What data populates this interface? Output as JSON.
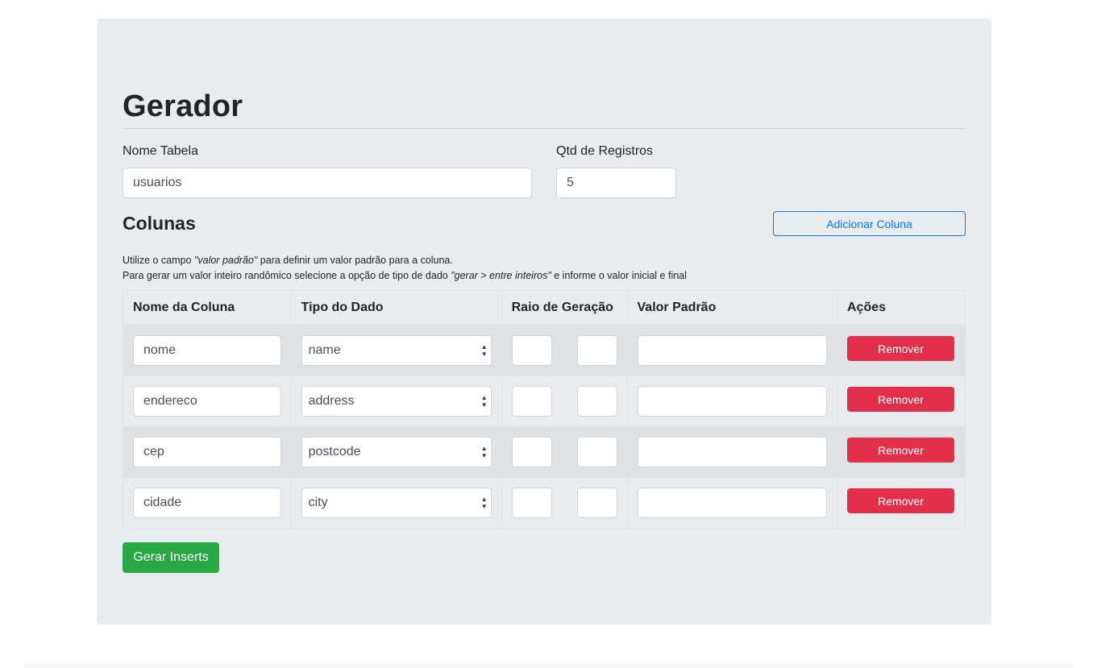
{
  "page": {
    "title": "Gerador"
  },
  "form": {
    "table_name_label": "Nome Tabela",
    "table_name_value": "usuarios",
    "qty_label": "Qtd de Registros",
    "qty_value": "5"
  },
  "columns_section": {
    "title": "Colunas",
    "add_button": "Adicionar Coluna",
    "help_line1_prefix": "Utilize o campo ",
    "help_line1_em": "\"valor padrão\"",
    "help_line1_suffix": " para definir um valor padrão para a coluna.",
    "help_line2_prefix": "Para gerar um valor inteiro randômico selecione a opção de tipo de dado ",
    "help_line2_em": "\"gerar > entre inteiros\"",
    "help_line2_suffix": " e informe o valor inicial e final"
  },
  "table": {
    "headers": [
      "Nome da Coluna",
      "Tipo do Dado",
      "Raio de Geração",
      "Valor Padrão",
      "Ações"
    ],
    "rows": [
      {
        "name": "nome",
        "type": "name",
        "range_min": "",
        "range_max": "",
        "default": "",
        "action": "Remover"
      },
      {
        "name": "endereco",
        "type": "address",
        "range_min": "",
        "range_max": "",
        "default": "",
        "action": "Remover"
      },
      {
        "name": "cep",
        "type": "postcode",
        "range_min": "",
        "range_max": "",
        "default": "",
        "action": "Remover"
      },
      {
        "name": "cidade",
        "type": "city",
        "range_min": "",
        "range_max": "",
        "default": "",
        "action": "Remover"
      }
    ]
  },
  "submit_button": "Gerar Inserts",
  "colors": {
    "primary": "#007bff",
    "danger": "#e3304a",
    "success": "#28a745",
    "jumbotron": "#e9ecef"
  }
}
